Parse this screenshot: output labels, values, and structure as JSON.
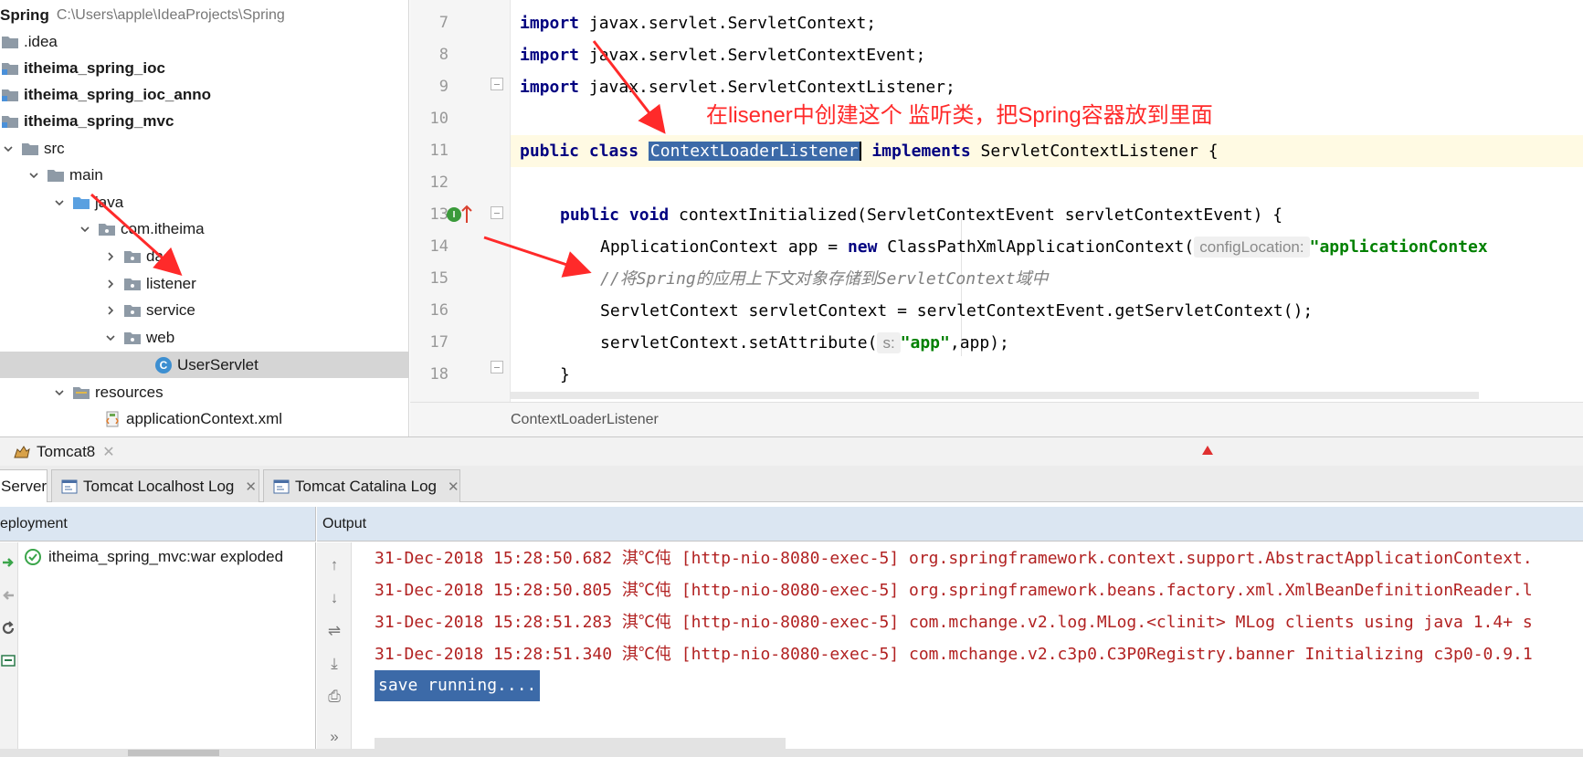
{
  "project_tree": {
    "root": {
      "name": "Spring",
      "path": "C:\\Users\\apple\\IdeaProjects\\Spring"
    },
    "items": [
      {
        "label": ".idea",
        "bold": false
      },
      {
        "label": "itheima_spring_ioc",
        "bold": true
      },
      {
        "label": "itheima_spring_ioc_anno",
        "bold": true
      },
      {
        "label": "itheima_spring_mvc",
        "bold": true
      },
      {
        "label": "src",
        "bold": false
      },
      {
        "label": "main",
        "bold": false
      },
      {
        "label": "java",
        "bold": false
      },
      {
        "label": "com.itheima",
        "bold": false
      },
      {
        "label": "dao",
        "bold": false
      },
      {
        "label": "listener",
        "bold": false
      },
      {
        "label": "service",
        "bold": false
      },
      {
        "label": "web",
        "bold": false
      },
      {
        "label": "UserServlet",
        "bold": false,
        "selected": true
      },
      {
        "label": "resources",
        "bold": false
      },
      {
        "label": "applicationContext.xml",
        "bold": false
      }
    ]
  },
  "editor": {
    "line_numbers": [
      "7",
      "8",
      "9",
      "10",
      "11",
      "12",
      "13",
      "14",
      "15",
      "16",
      "17",
      "18"
    ],
    "code": {
      "l7_kw": "import",
      "l7_rest": " javax.servlet.ServletContext;",
      "l8_kw": "import",
      "l8_rest": " javax.servlet.ServletContextEvent;",
      "l9_kw": "import",
      "l9_rest": " javax.servlet.ServletContextListener;",
      "l11_kw": "public class",
      "l11_sel": "ContextLoaderListener",
      "l11_impl": "implements",
      "l11_rest": " ServletContextListener {",
      "l13_kw": "public void",
      "l13_rest": " contextInitialized(ServletContextEvent servletContextEvent) {",
      "l14_a": "ApplicationContext app = ",
      "l14_kw": "new",
      "l14_b": " ClassPathXmlApplicationContext(",
      "l14_hint": "configLocation:",
      "l14_str": "\"applicationContex",
      "l15_comment": "//将Spring的应用上下文对象存储到ServletContext域中",
      "l16": "ServletContext servletContext = servletContextEvent.getServletContext();",
      "l17_a": "servletContext.setAttribute(",
      "l17_hint": "s:",
      "l17_str": "\"app\"",
      "l17_b": ",app);",
      "l18": "}"
    },
    "breadcrumb": "ContextLoaderListener",
    "annotation": "在lisener中创建这个 监听类，把Spring容器放到里面"
  },
  "tool_window": {
    "title": "Tomcat8",
    "tabs": [
      {
        "label": "Server",
        "active": true
      },
      {
        "label": "Tomcat Localhost Log",
        "active": false
      },
      {
        "label": "Tomcat Catalina Log",
        "active": false
      }
    ],
    "deployment_header": "eployment",
    "output_header": "Output",
    "deployment_item": "itheima_spring_mvc:war exploded",
    "log_lines": [
      "31-Dec-2018 15:28:50.682 淇℃伅 [http-nio-8080-exec-5] org.springframework.context.support.AbstractApplicationContext.",
      "31-Dec-2018 15:28:50.805 淇℃伅 [http-nio-8080-exec-5] org.springframework.beans.factory.xml.XmlBeanDefinitionReader.l",
      "31-Dec-2018 15:28:51.283 淇℃伅 [http-nio-8080-exec-5] com.mchange.v2.log.MLog.<clinit> MLog clients using java 1.4+ s",
      "31-Dec-2018 15:28:51.340 淇℃伅 [http-nio-8080-exec-5] com.mchange.v2.c3p0.C3P0Registry.banner Initializing c3p0-0.9.1"
    ],
    "save_running": "save running....",
    "more_glyph": "»"
  },
  "colors": {
    "keyword": "#000080",
    "string": "#008000",
    "comment": "#808080",
    "selection": "#3c6aa8",
    "log_text": "#b22222",
    "annotation": "#ff2a2a",
    "panel_header": "#dbe6f2"
  },
  "icons": [
    "folder-icon",
    "module-folder-icon",
    "source-folder-icon",
    "package-icon",
    "class-icon",
    "xml-file-icon",
    "chevron-right-icon",
    "chevron-down-icon",
    "override-gutter-icon",
    "tomcat-icon",
    "log-tab-icon",
    "check-circle-icon",
    "scroll-up-icon",
    "scroll-down-icon",
    "soft-wrap-icon",
    "scroll-to-end-icon",
    "print-icon"
  ]
}
